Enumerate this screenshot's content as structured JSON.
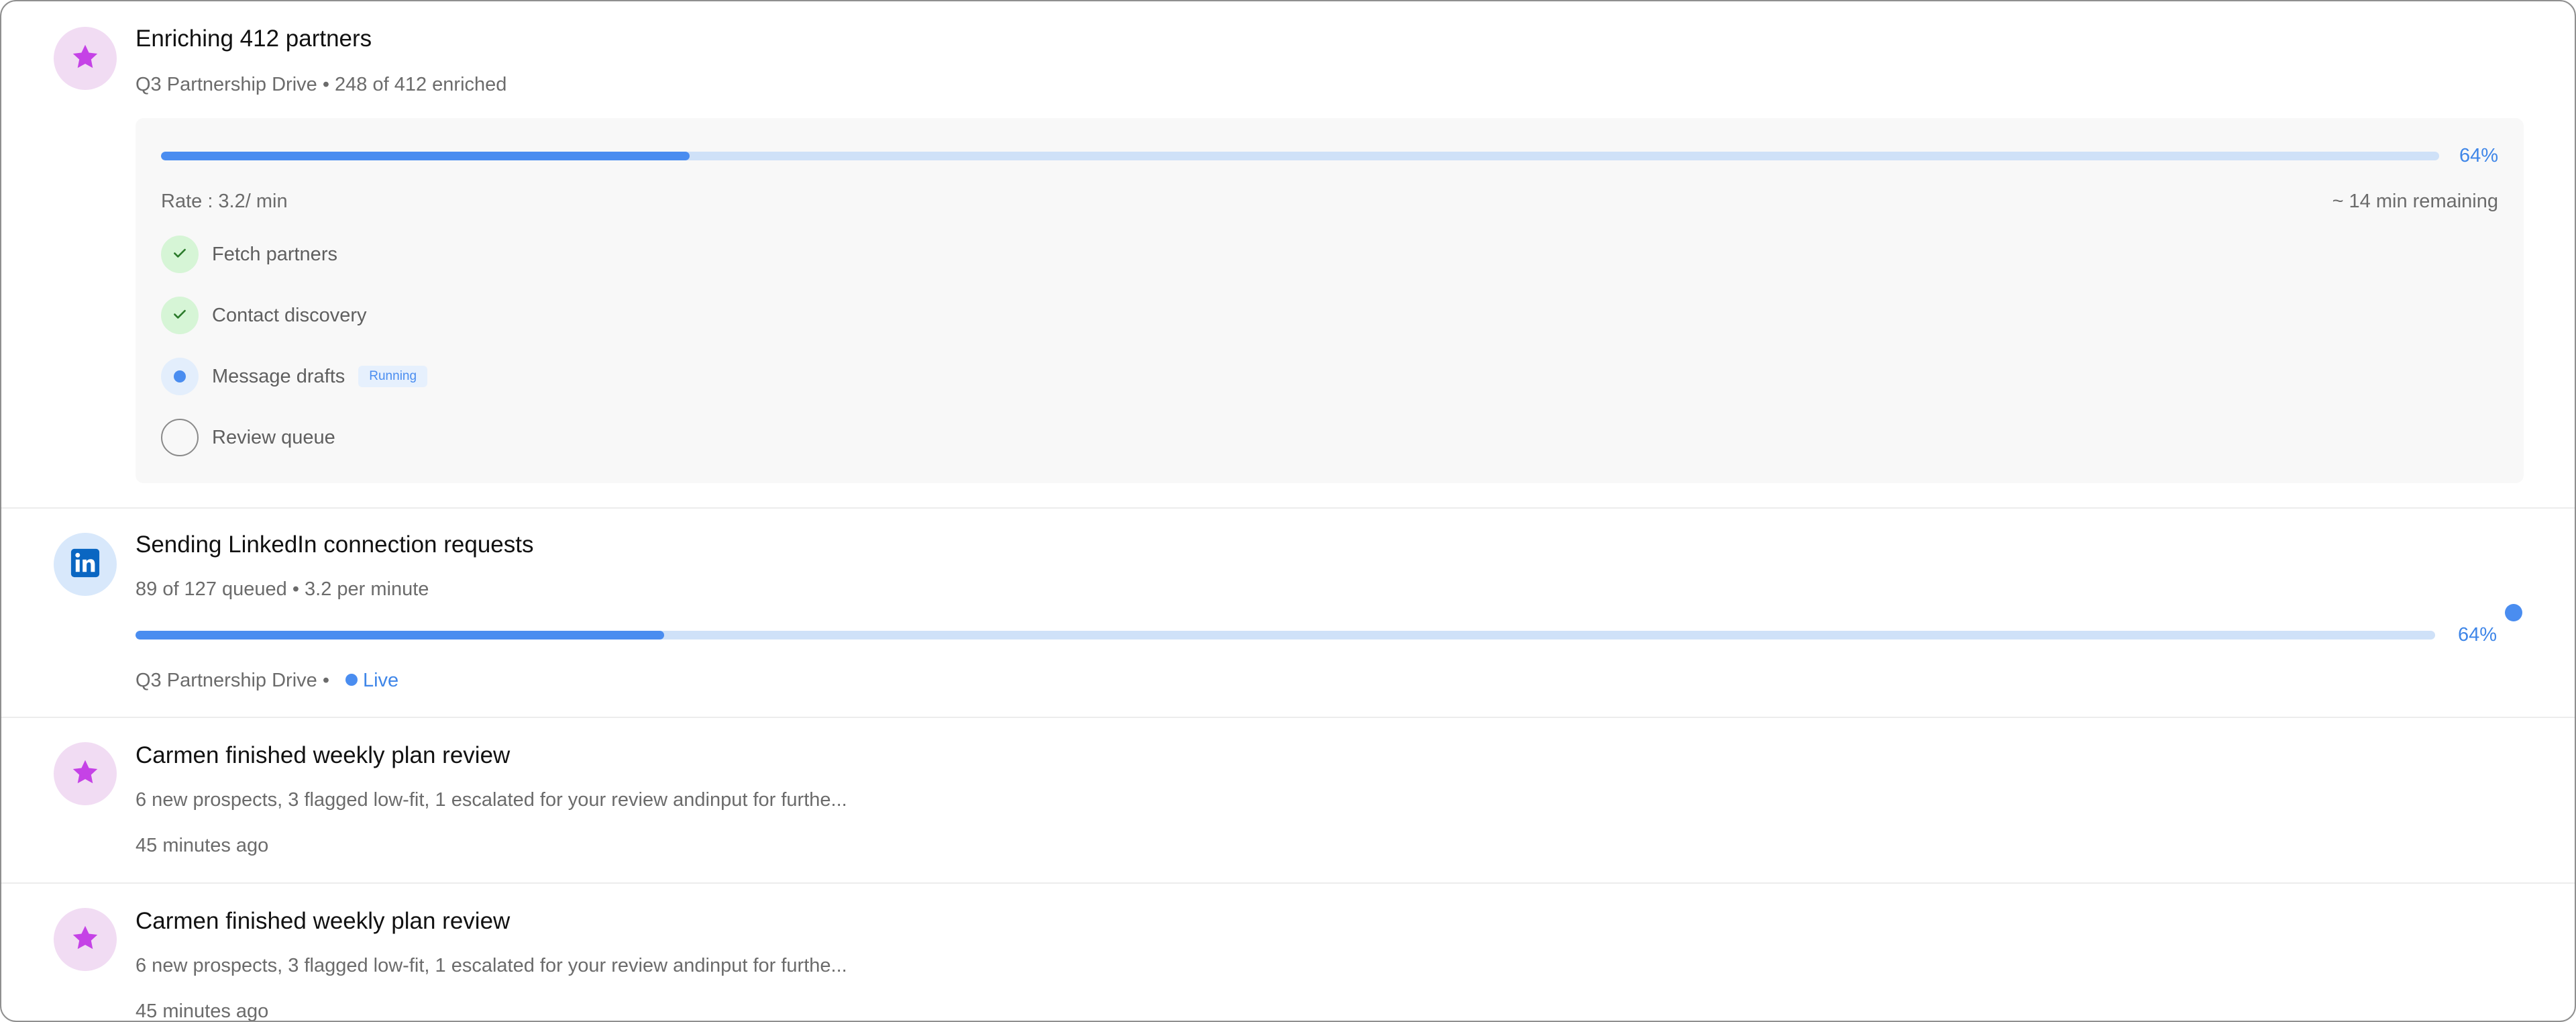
{
  "feed": {
    "enrichment": {
      "icon": "star-icon",
      "title": "Enriching 412 partners",
      "subtitle": "Q3 Partnership Drive • 248 of 412 enriched",
      "progress_fraction": 0.232,
      "percent_label": "64%",
      "rate": "Rate : 3.2/ min",
      "remaining": "~ 14 min remaining",
      "steps": [
        {
          "label": "Fetch partners",
          "status": "done"
        },
        {
          "label": "Contact discovery",
          "status": "done"
        },
        {
          "label": "Message drafts",
          "status": "running",
          "badge": "Running"
        },
        {
          "label": "Review queue",
          "status": "pending"
        }
      ]
    },
    "linkedin": {
      "icon": "linkedin-icon",
      "title": "Sending LinkedIn connection requests",
      "subtitle": "89 of 127 queued • 3.2 per minute",
      "progress_fraction": 0.23,
      "percent_label": "64%",
      "campaign": "Q3 Partnership Drive •",
      "live_label": "Live"
    },
    "reviews": [
      {
        "icon": "star-icon",
        "title": "Carmen finished weekly plan review",
        "description": "6 new prospects, 3 flagged low-fit, 1 escalated for your review andinput for furthe...",
        "time": "45 minutes ago"
      },
      {
        "icon": "star-icon",
        "title": "Carmen finished weekly plan review",
        "description": "6 new prospects, 3 flagged low-fit, 1 escalated for your review andinput for furthe...",
        "time": "45 minutes ago"
      }
    ]
  },
  "colors": {
    "accent": "#4a8df0",
    "track": "#cfe1f8",
    "star": "#c542e6",
    "linkedin": "#0a66c2",
    "done": "#d6f5d6",
    "check": "#2b7a2b"
  }
}
